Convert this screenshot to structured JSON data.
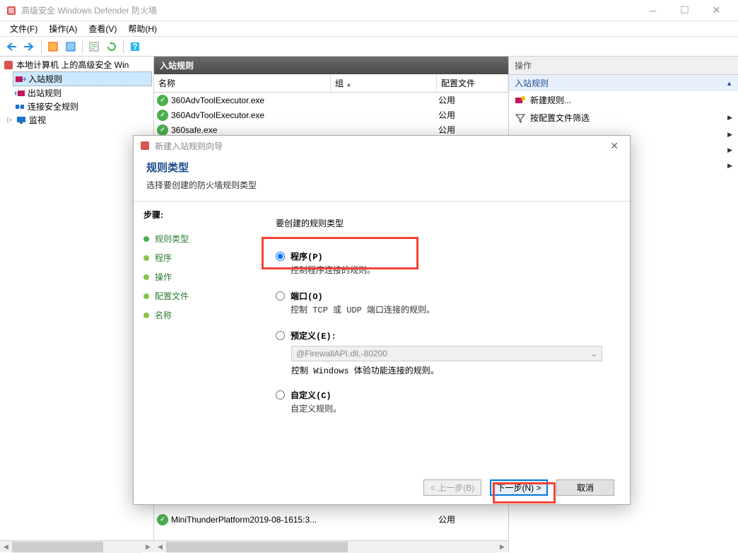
{
  "window": {
    "title": "高级安全 Windows Defender 防火墙"
  },
  "menu": {
    "file": "文件(F)",
    "action": "操作(A)",
    "view": "查看(V)",
    "help": "帮助(H)"
  },
  "tree": {
    "root": "本地计算机 上的高级安全 Win",
    "inbound": "入站规则",
    "outbound": "出站规则",
    "connsec": "连接安全规则",
    "monitor": "监视"
  },
  "center": {
    "header": "入站规则",
    "cols": {
      "name": "名称",
      "group": "组",
      "profile": "配置文件"
    },
    "rows": [
      {
        "name": "360AdvToolExecutor.exe",
        "group": "",
        "profile": "公用"
      },
      {
        "name": "360AdvToolExecutor.exe",
        "group": "",
        "profile": "公用"
      },
      {
        "name": "360safe.exe",
        "group": "",
        "profile": "公用"
      },
      {
        "name": "MiniThunderPlatform2019-08-1615:3...",
        "group": "",
        "profile": "公用"
      }
    ],
    "sort_arrow": "▲"
  },
  "actions": {
    "header": "操作",
    "section": "入站规则",
    "items": [
      {
        "label": "新建规则...",
        "icon": "new-rule"
      },
      {
        "label": "按配置文件筛选",
        "icon": "filter",
        "chevron": true
      },
      {
        "label": "",
        "icon": "",
        "chevron": true
      },
      {
        "label": "",
        "icon": "",
        "chevron": true
      },
      {
        "label": "",
        "icon": "",
        "chevron": true
      }
    ]
  },
  "wizard": {
    "title": "新建入站规则向导",
    "heading": "规则类型",
    "subheading": "选择要创建的防火墙规则类型",
    "steps_label": "步骤:",
    "steps": [
      "规则类型",
      "程序",
      "操作",
      "配置文件",
      "名称"
    ],
    "prompt": "要创建的规则类型",
    "options": {
      "program": {
        "label": "程序(P)",
        "desc": "控制程序连接的规则。"
      },
      "port": {
        "label": "端口(O)",
        "desc": "控制 TCP 或 UDP 端口连接的规则。"
      },
      "predefined": {
        "label": "预定义(E):",
        "combo": "@FirewallAPI.dll,-80200",
        "desc": "控制 Windows 体验功能连接的规则。"
      },
      "custom": {
        "label": "自定义(C)",
        "desc": "自定义规则。"
      }
    },
    "buttons": {
      "back": "< 上一步(B)",
      "next": "下一步(N) >",
      "cancel": "取消"
    }
  }
}
